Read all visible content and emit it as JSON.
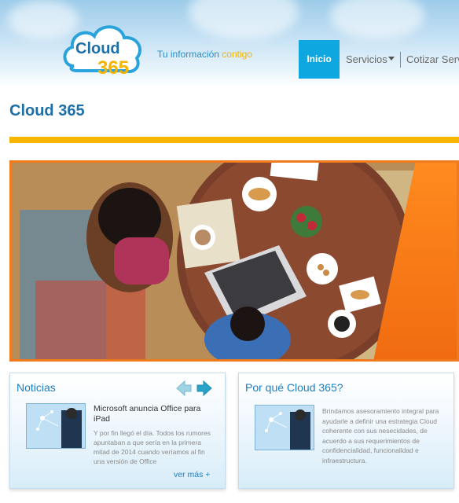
{
  "brand": {
    "logo_word": "Cloud",
    "logo_number": "365",
    "tagline_main": "Tu información",
    "tagline_accent": "contigo"
  },
  "nav": {
    "home_label": "Inicio",
    "services_label": "Servicios",
    "quote_label": "Cotizar Servicios"
  },
  "page": {
    "title": "Cloud 365"
  },
  "news": {
    "title": "Noticias",
    "headline": "Microsoft anuncia Office para iPad",
    "body": "Y por fin llegó el día. Todos los rumores apuntaban a que sería en la primera mitad de 2014 cuando veríamos al fin una versión de Office",
    "more_label": "ver más +"
  },
  "why": {
    "title": "Por qué Cloud 365?",
    "body": "Brindamos asesoramiento integral para ayudarle a definir una estrategia Cloud coherente con sus nesecidades, de acuerdo a sus requerimientos de confidencialidad, funcionalidad e infraestructura."
  },
  "colors": {
    "brand_blue": "#1d7fc1",
    "accent_yellow": "#f7b500",
    "nav_active": "#0fa7df",
    "hero_border": "#f07a1e"
  }
}
